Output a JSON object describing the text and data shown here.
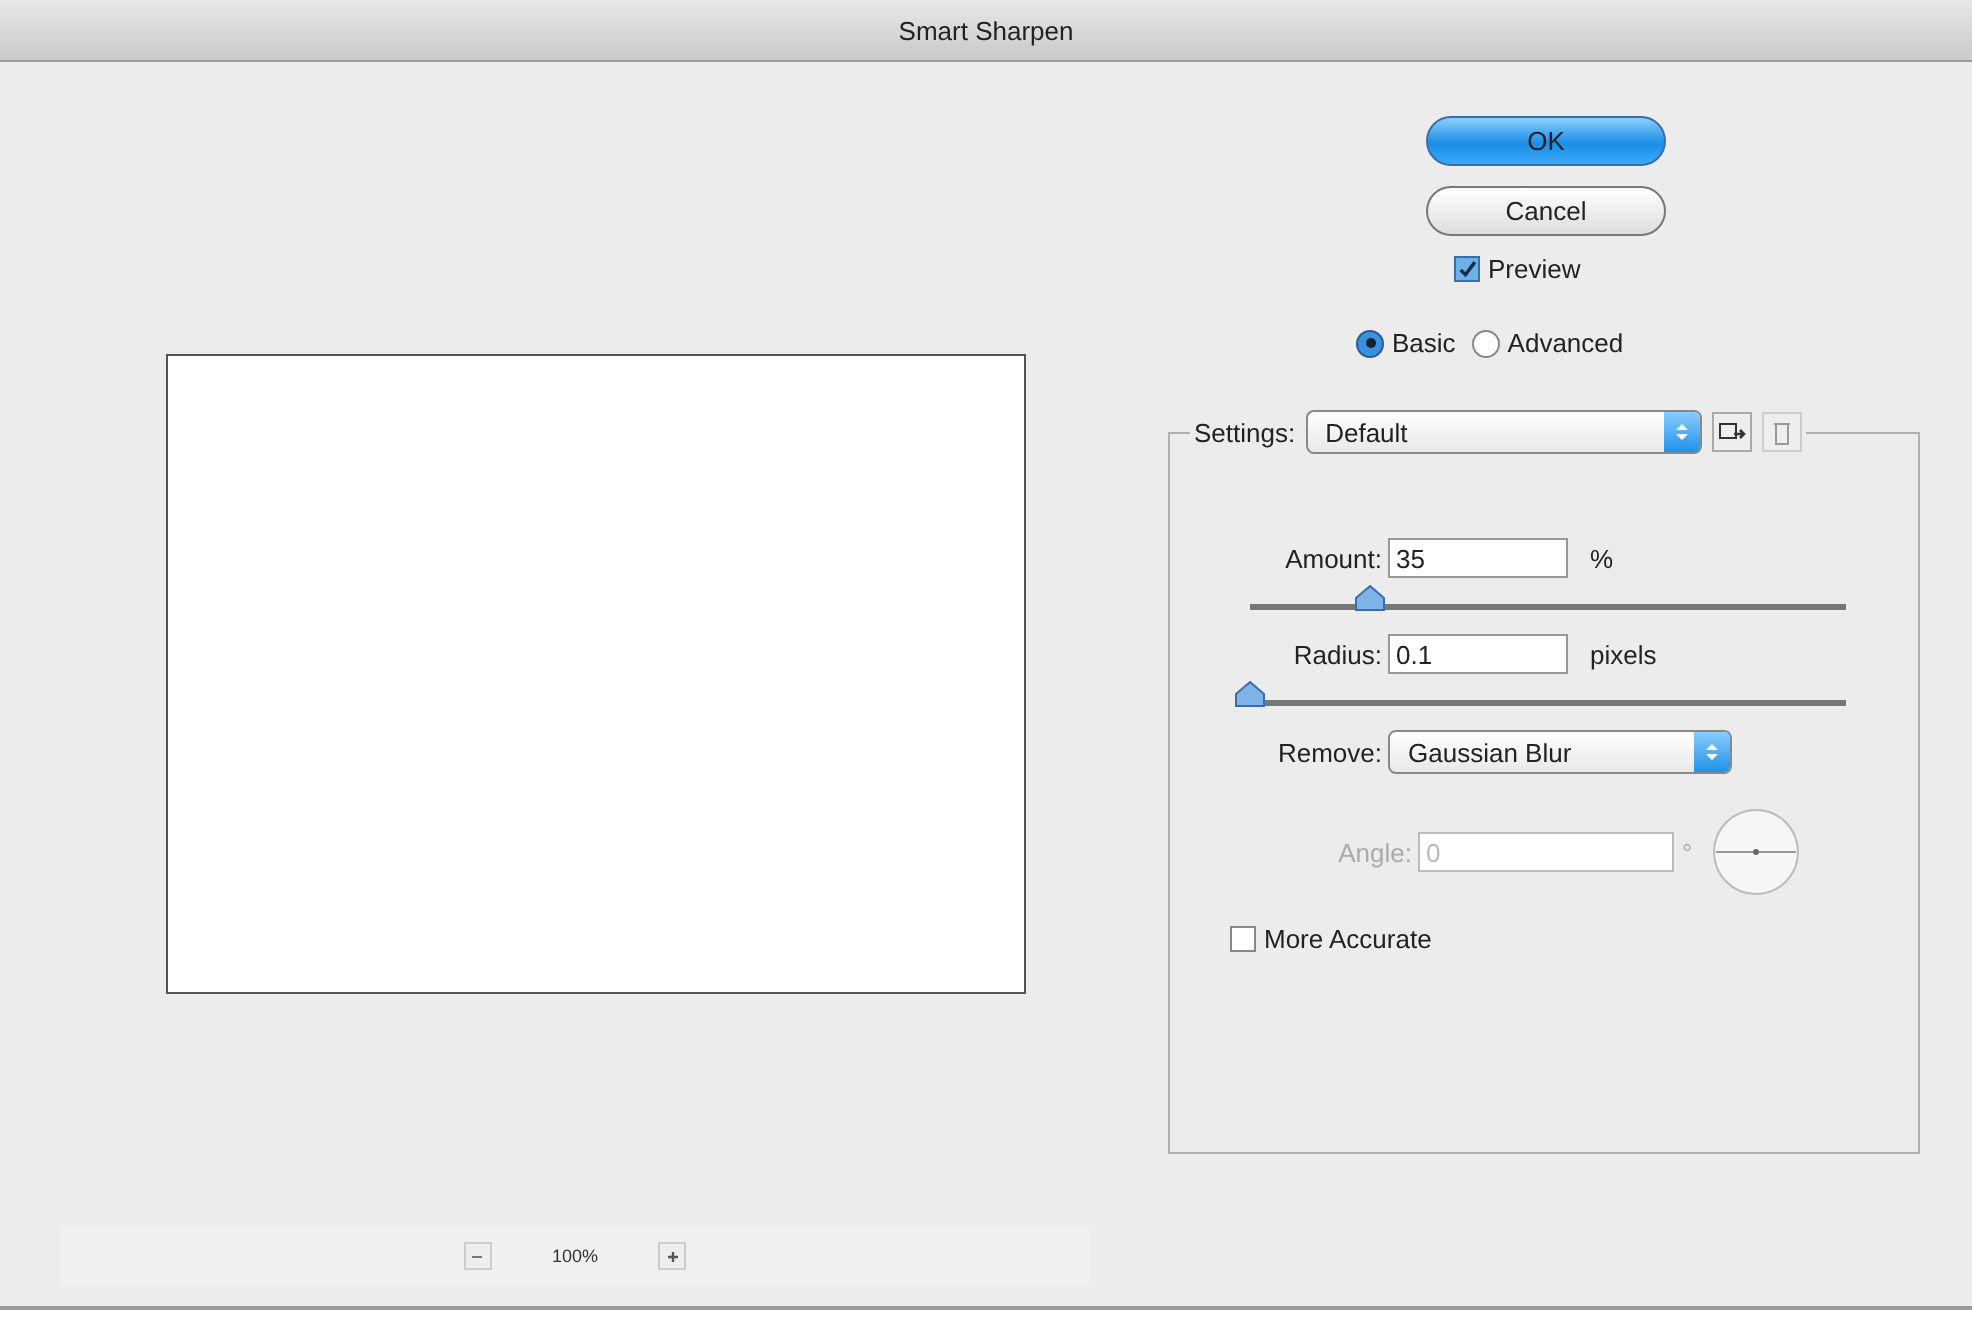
{
  "window": {
    "title": "Smart Sharpen"
  },
  "buttons": [
    {
      "label": "OK",
      "default": true
    },
    {
      "label": "Cancel",
      "default": false
    }
  ],
  "preview": {
    "label": "Preview",
    "checked": true
  },
  "modes": [
    {
      "label": "Basic",
      "selected": true
    },
    {
      "label": "Advanced",
      "selected": false
    }
  ],
  "settings": {
    "label": "Settings:",
    "value": "Default"
  },
  "parameters": [
    {
      "label": "Amount:",
      "value": "35",
      "unit": "%",
      "level": 0.19
    },
    {
      "label": "Radius:",
      "value": "0.1",
      "unit": "pixels",
      "level": 0
    }
  ],
  "remove": {
    "label": "Remove:",
    "value": "Gaussian Blur"
  },
  "angle": {
    "label": "Angle:",
    "value": "0",
    "unit": "°",
    "disabled": true
  },
  "more_accurate": {
    "label": "More Accurate",
    "checked": false
  },
  "zoom": {
    "value": "100%"
  }
}
